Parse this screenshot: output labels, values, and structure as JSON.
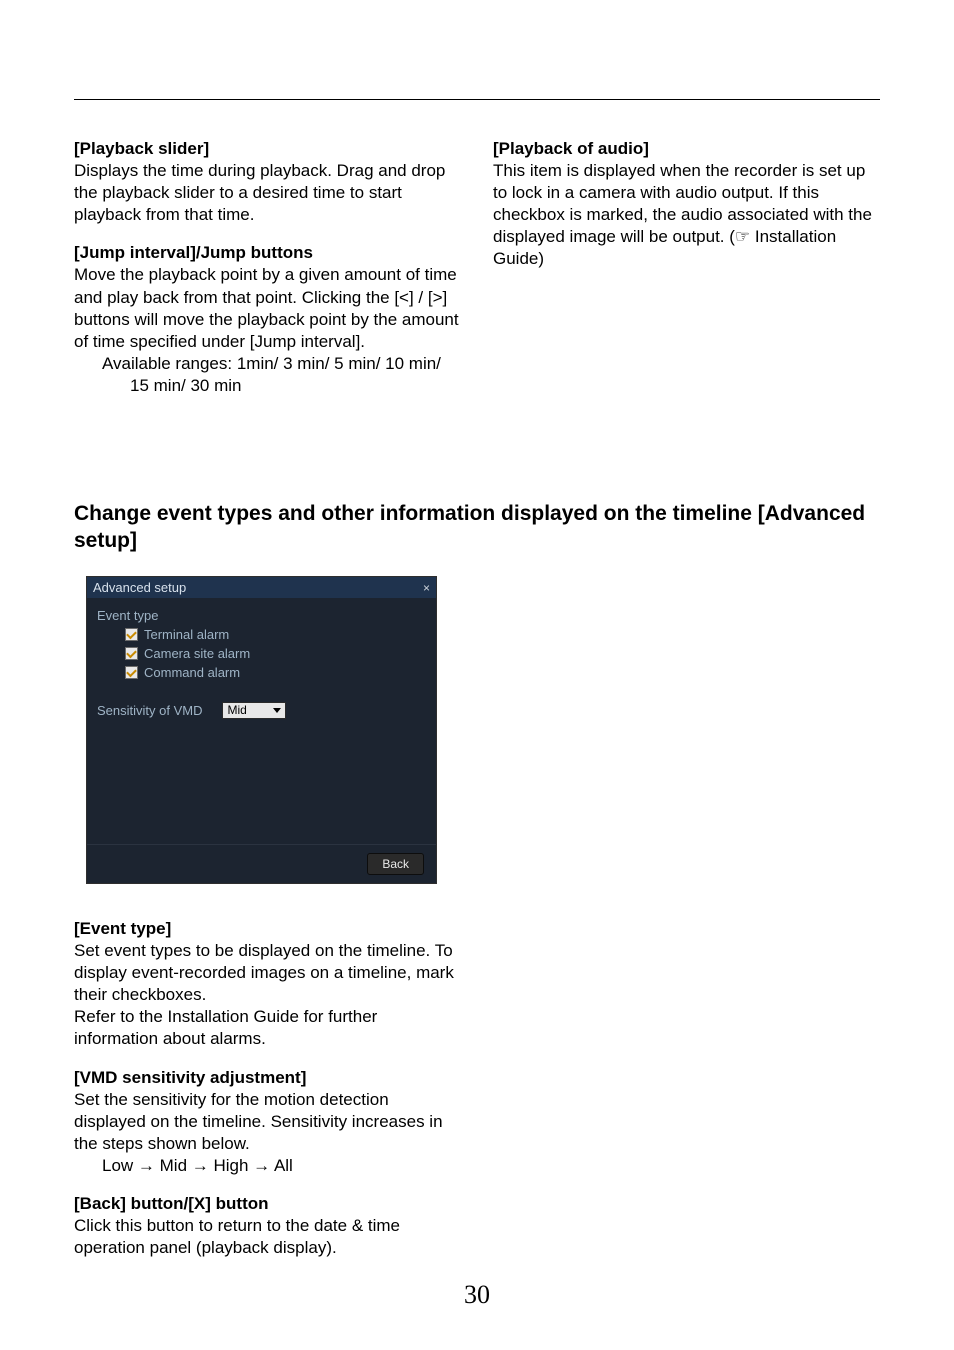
{
  "col_left": {
    "h1": "[Playback slider]",
    "p1": "Displays the time during playback. Drag and drop the playback slider to a desired time to start playback from that time.",
    "h2": "[Jump interval]/Jump buttons",
    "p2": "Move the playback point by a given amount of time and play back from that point. Clicking the [<] / [>] buttons will move the playback point by the amount of time specified under [Jump interval].",
    "p2a": "Available ranges: 1min/ 3 min/ 5 min/ 10 min/",
    "p2b": "15 min/ 30 min"
  },
  "col_right": {
    "h1": "[Playback of audio]",
    "p1": "This item is displayed when the recorder is set up to lock in a camera with audio output. If this checkbox is marked, the audio associated with the displayed image will be output. (☞ Installation Guide)"
  },
  "section_heading": "Change event types and other information displayed on the timeline [Advanced setup]",
  "dialog": {
    "title": "Advanced setup",
    "event_type_label": "Event type",
    "items": [
      "Terminal alarm",
      "Camera site alarm",
      "Command alarm"
    ],
    "sens_label": "Sensitivity of VMD",
    "sens_value": "Mid",
    "back": "Back"
  },
  "lower": {
    "h1": "[Event type]",
    "p1": "Set event types to be displayed on the timeline. To display event-recorded images on a timeline, mark their checkboxes.",
    "p1a": "Refer to the Installation Guide for further information about alarms.",
    "h2": "[VMD sensitivity adjustment]",
    "p2": "Set the sensitivity for the motion detection displayed on the timeline. Sensitivity increases in the steps shown below.",
    "p2a": "Low → Mid → High → All",
    "h3": "[Back] button/[X] button",
    "p3": "Click this button to return to the date & time operation panel (playback display)."
  },
  "page": "30"
}
